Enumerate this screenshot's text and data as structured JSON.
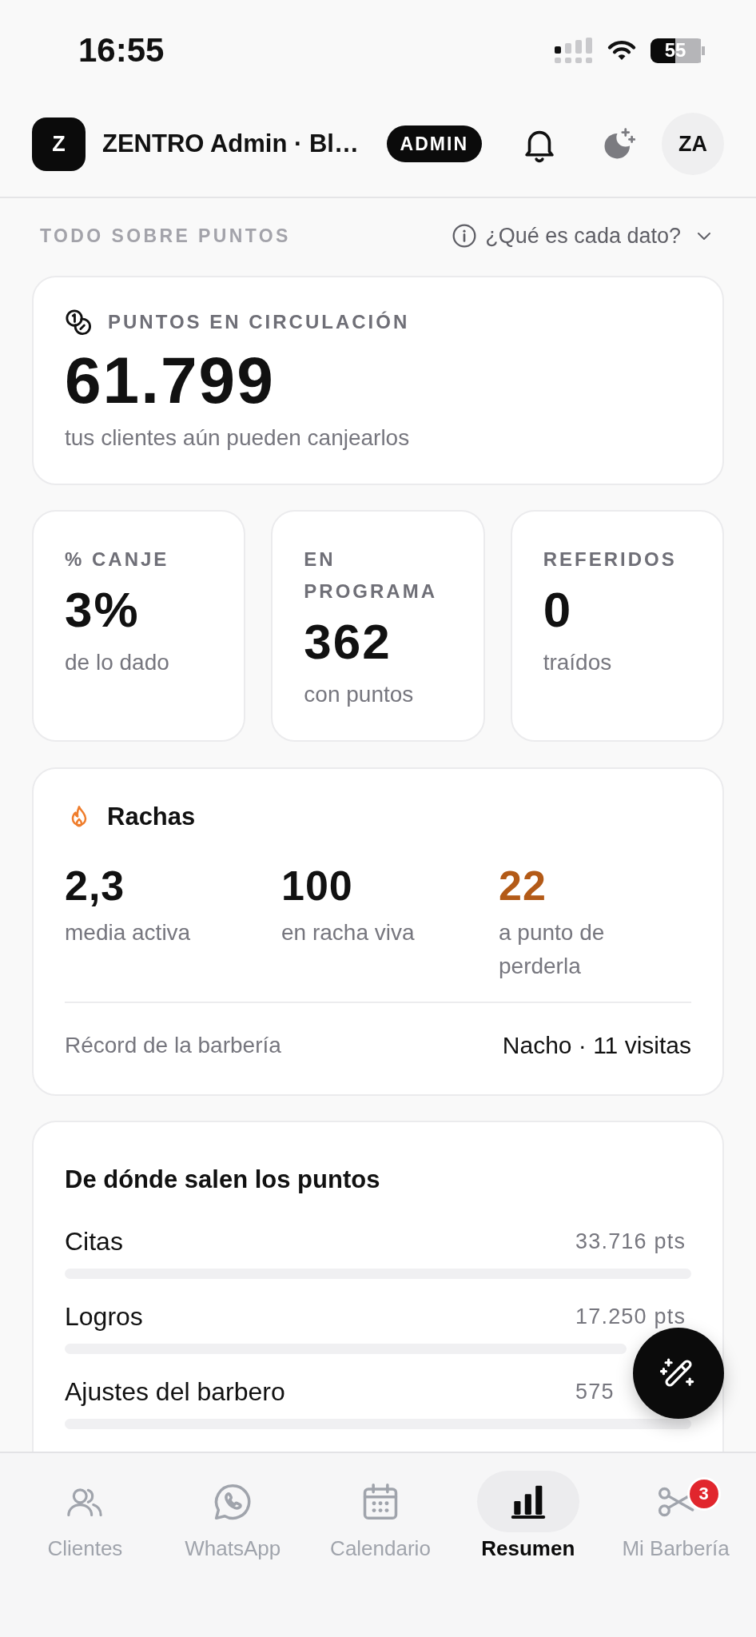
{
  "status_bar": {
    "time": "16:55",
    "battery": "55"
  },
  "header": {
    "logo": "Z",
    "title": "ZENTRO Admin · Bl…",
    "role_badge": "ADMIN",
    "avatar": "ZA"
  },
  "section": {
    "title": "TODO SOBRE PUNTOS",
    "help": "¿Qué es cada dato?",
    "expanded": false
  },
  "circulation": {
    "label": "PUNTOS EN CIRCULACIÓN",
    "value": "61.799",
    "caption": "tus clientes aún pueden canjearlos"
  },
  "metrics": [
    {
      "label": "% CANJE",
      "value": "3%",
      "caption": "de lo dado"
    },
    {
      "label": "EN PROGRAMA",
      "value": "362",
      "caption": "con puntos"
    },
    {
      "label": "REFERIDOS",
      "value": "0",
      "caption": "traídos"
    }
  ],
  "streaks": {
    "title": "Rachas",
    "stats": [
      {
        "value": "2,3",
        "caption": "media activa",
        "color": "#111111"
      },
      {
        "value": "100",
        "caption": "en racha viva",
        "color": "#111111"
      },
      {
        "value": "22",
        "caption": "a punto de perderla",
        "color": "#b35a17"
      }
    ],
    "record_label": "Récord de la barbería",
    "record_value": "Nacho · 11 visitas"
  },
  "sources": {
    "title": "De dónde salen los puntos",
    "rows": [
      {
        "name": "Citas",
        "value": "33.716 pts",
        "level": 0
      },
      {
        "name": "Logros",
        "value": "17.250 pts",
        "level": 0
      },
      {
        "name": "Ajustes del barbero",
        "value": "575",
        "level": 0
      }
    ]
  },
  "tab_bar": [
    {
      "label": "Clientes",
      "selected": false
    },
    {
      "label": "WhatsApp",
      "selected": false
    },
    {
      "label": "Calendario",
      "selected": false
    },
    {
      "label": "Resumen",
      "selected": true
    },
    {
      "label": "Mi Barbería",
      "selected": false,
      "badge": "3"
    }
  ]
}
